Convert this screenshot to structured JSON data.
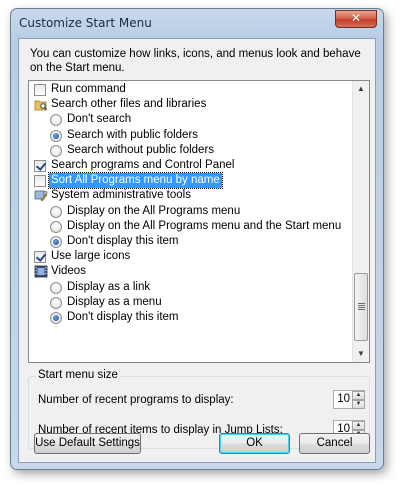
{
  "window": {
    "title": "Customize Start Menu",
    "close_glyph": "✕"
  },
  "description": "You can customize how links, icons, and menus look and behave on the Start menu.",
  "options": [
    {
      "type": "checkbox",
      "label": "Run command",
      "checked": false,
      "indent": 0
    },
    {
      "type": "icon",
      "icon": "folder-search-icon",
      "label": "Search other files and libraries",
      "indent": 0
    },
    {
      "type": "radio",
      "label": "Don't search",
      "checked": false,
      "indent": 1
    },
    {
      "type": "radio",
      "label": "Search with public folders",
      "checked": true,
      "indent": 1
    },
    {
      "type": "radio",
      "label": "Search without public folders",
      "checked": false,
      "indent": 1
    },
    {
      "type": "checkbox",
      "label": "Search programs and Control Panel",
      "checked": true,
      "indent": 0
    },
    {
      "type": "checkbox",
      "label": "Sort All Programs menu by name",
      "checked": false,
      "indent": 0,
      "selected": true
    },
    {
      "type": "icon",
      "icon": "admin-tools-icon",
      "label": "System administrative tools",
      "indent": 0
    },
    {
      "type": "radio",
      "label": "Display on the All Programs menu",
      "checked": false,
      "indent": 1
    },
    {
      "type": "radio",
      "label": "Display on the All Programs menu and the Start menu",
      "checked": false,
      "indent": 1
    },
    {
      "type": "radio",
      "label": "Don't display this item",
      "checked": true,
      "indent": 1
    },
    {
      "type": "checkbox",
      "label": "Use large icons",
      "checked": true,
      "indent": 0
    },
    {
      "type": "icon",
      "icon": "videos-icon",
      "label": "Videos",
      "indent": 0
    },
    {
      "type": "radio",
      "label": "Display as a link",
      "checked": false,
      "indent": 1
    },
    {
      "type": "radio",
      "label": "Display as a menu",
      "checked": false,
      "indent": 1
    },
    {
      "type": "radio",
      "label": "Don't display this item",
      "checked": true,
      "indent": 1
    }
  ],
  "size_group": {
    "title": "Start menu size",
    "recent_programs_label": "Number of recent programs to display:",
    "recent_programs_value": "10",
    "jump_list_label": "Number of recent items to display in Jump Lists:",
    "jump_list_value": "10"
  },
  "buttons": {
    "defaults": "Use Default Settings",
    "ok": "OK",
    "cancel": "Cancel"
  },
  "colors": {
    "selection": "#3399ff",
    "title_gradient": "#b8cde6",
    "close_button": "#c13f28"
  }
}
